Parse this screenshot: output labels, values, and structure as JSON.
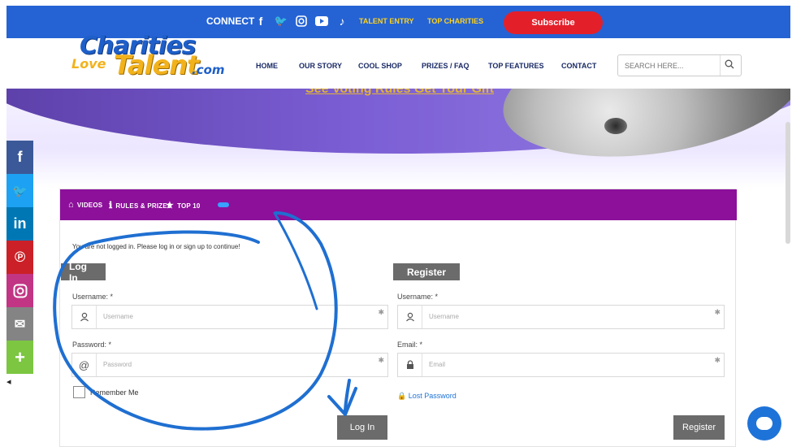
{
  "topbar": {
    "connect_label": "CONNECT",
    "social_icons": [
      "facebook-icon",
      "twitter-icon",
      "instagram-icon",
      "youtube-icon",
      "tiktok-icon"
    ],
    "talent_entry": "TALENT ENTRY",
    "top_charities": "TOP CHARITIES",
    "subscribe_label": "Subscribe",
    "bg_color": "#2563d4",
    "link_color": "#ffd21c",
    "subscribe_color": "#e3202a"
  },
  "logo": {
    "line1": "Charities",
    "line2a": "Love",
    "line2b": "Talent",
    "line2c": ".com"
  },
  "nav": {
    "items": [
      "HOME",
      "OUR STORY",
      "COOL SHOP",
      "PRIZES / FAQ",
      "TOP FEATURES",
      "CONTACT"
    ],
    "search_placeholder": "SEARCH HERE..."
  },
  "hero": {
    "text": "See Voting Rules  Get Your Gift"
  },
  "social_sidebar": {
    "buttons": [
      {
        "icon": "facebook-icon",
        "glyph": "f",
        "color": "#3b5998"
      },
      {
        "icon": "twitter-icon",
        "glyph": "🐦",
        "color": "#1da1f2"
      },
      {
        "icon": "linkedin-icon",
        "glyph": "in",
        "color": "#0077b5"
      },
      {
        "icon": "pinterest-icon",
        "glyph": "P",
        "color": "#cb2027"
      },
      {
        "icon": "instagram-icon",
        "glyph": "◎",
        "color": "#c13584"
      },
      {
        "icon": "email-icon",
        "glyph": "✉",
        "color": "#848484"
      },
      {
        "icon": "more-icon",
        "glyph": "+",
        "color": "#7cc641"
      }
    ]
  },
  "tabs": {
    "videos": "VIDEOS",
    "rules": "RULES & PRIZES",
    "top10": "TOP 10"
  },
  "panel": {
    "notice": "You are not logged in. Please log in or sign up to continue!",
    "bar_color": "#8c109a"
  },
  "login": {
    "title": "Log In",
    "username_label": "Username: *",
    "username_placeholder": "Username",
    "password_label": "Password: *",
    "password_placeholder": "Password",
    "remember_label": "Remember Me",
    "submit_label": "Log In"
  },
  "register": {
    "title": "Register",
    "username_label": "Username: *",
    "username_placeholder": "Username",
    "email_label": "Email: *",
    "email_placeholder": "Email",
    "lost_password": "Lost Password",
    "submit_label": "Register"
  },
  "icons": {
    "user": "user-icon",
    "at": "at-icon",
    "lock": "lock-icon",
    "search": "search-icon",
    "chat": "chat-icon"
  }
}
